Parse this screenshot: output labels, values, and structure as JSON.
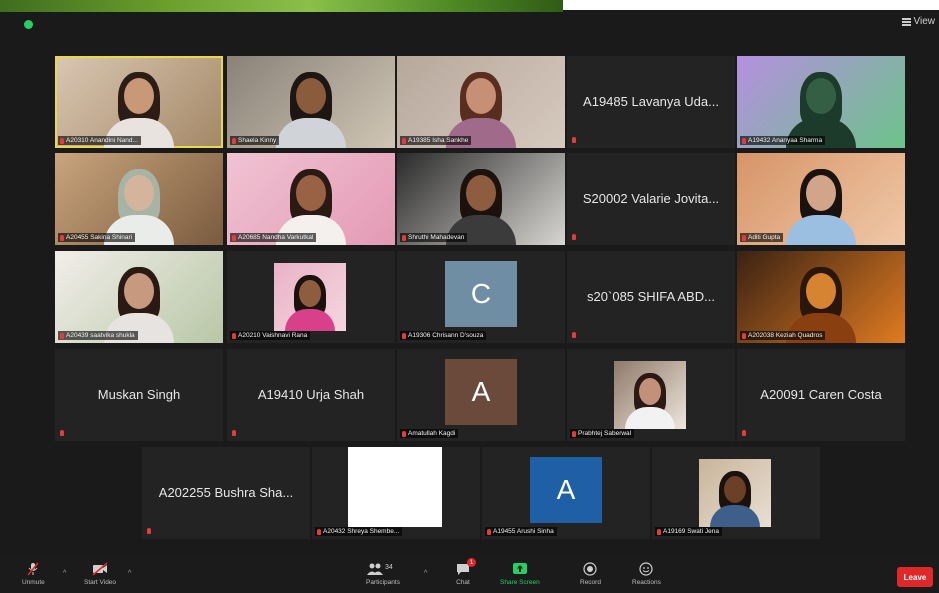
{
  "window": {
    "view_label": "View",
    "colors": {
      "background": "#1a1a1a",
      "tile": "#232323",
      "active_border": "#e8d84a",
      "leave": "#e02828",
      "share_screen": "#23d160"
    }
  },
  "participants": [
    {
      "caption": "A20310 Anandini Nand...",
      "kind": "video",
      "active": true
    },
    {
      "caption": "Shaela Kinny",
      "kind": "video"
    },
    {
      "caption": "A19385 Isha Sankhe",
      "kind": "video"
    },
    {
      "name": "A19485 Lavanya Uda...",
      "kind": "name"
    },
    {
      "caption": "A19432 Ananyaa Sharma",
      "kind": "video"
    },
    {
      "caption": "A20455 Sakina Shinari",
      "kind": "video"
    },
    {
      "caption": "A20685 Nandha Varkutkal",
      "kind": "video"
    },
    {
      "caption": "Shruthi Mahadevan",
      "kind": "video"
    },
    {
      "name": "S20002 Valarie Jovita...",
      "kind": "name"
    },
    {
      "caption": "Aditi Gupta",
      "kind": "video"
    },
    {
      "caption": "A20439 saatvika shukla",
      "kind": "video"
    },
    {
      "caption": "A20210 Vaishnavi Rana",
      "kind": "photo"
    },
    {
      "caption": "A19306 Chrisann D'souza",
      "kind": "avatar",
      "letter": "C",
      "color": "#6f8ea3"
    },
    {
      "name": "s20`085 SHIFA ABD...",
      "kind": "name"
    },
    {
      "caption": "A202038 Keziah Quadros",
      "kind": "video"
    },
    {
      "name": "Muskan Singh",
      "kind": "name"
    },
    {
      "name": "A19410 Urja Shah",
      "kind": "name"
    },
    {
      "caption": "Amatullah Kagdi",
      "kind": "avatar",
      "letter": "A",
      "color": "#6b4a3b"
    },
    {
      "caption": "Prabhtej Saberwal",
      "kind": "photo"
    },
    {
      "name": "A20091 Caren Costa",
      "kind": "name"
    },
    {
      "name": "A202255 Bushra Sha...",
      "kind": "name"
    },
    {
      "caption": "A20432 Shreya Shembe...",
      "kind": "white"
    },
    {
      "caption": "A19455 Arushi Sinha",
      "kind": "avatar",
      "letter": "A",
      "color": "#1e5fa6"
    },
    {
      "caption": "A19169 Swati Jena",
      "kind": "photo"
    }
  ],
  "toolbar": {
    "unmute": "Unmute",
    "start_video": "Start Video",
    "participants": "Participants",
    "participants_count": "34",
    "chat": "Chat",
    "chat_badge": "1",
    "share_screen": "Share Screen",
    "record": "Record",
    "reactions": "Reactions",
    "leave": "Leave"
  }
}
